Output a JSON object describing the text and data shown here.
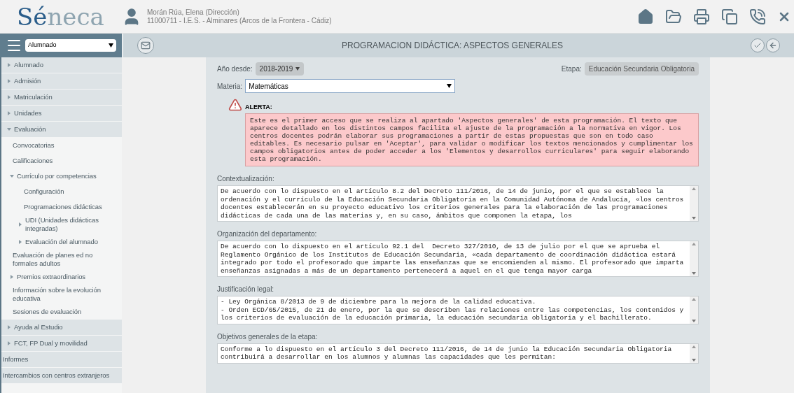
{
  "header": {
    "logo": "Séneca",
    "user_name": "Morán Rúa, Elena (Dirección)",
    "center": "11000711 - I.E.S. - Alminares (Arcos de la Frontera - Cádiz)"
  },
  "profile_select": {
    "value": "Alumnado"
  },
  "page_title": "PROGRAMACION DIDÁCTICA: ASPECTOS GENERALES",
  "sidebar": {
    "items": [
      {
        "label": "Alumnado",
        "expanded": false
      },
      {
        "label": "Admisión",
        "expanded": false
      },
      {
        "label": "Matriculación",
        "expanded": false
      },
      {
        "label": "Unidades",
        "expanded": false
      },
      {
        "label": "Evaluación",
        "expanded": true,
        "children": [
          {
            "label": "Convocatorias"
          },
          {
            "label": "Calificaciones"
          },
          {
            "label": "Currículo por competencias",
            "expanded": true,
            "children": [
              {
                "label": "Configuración"
              },
              {
                "label": "Programaciones didácticas"
              },
              {
                "label": "UDI (Unidades didácticas integradas)",
                "expanded": false
              },
              {
                "label": "Evaluación del alumnado",
                "expanded": false
              }
            ]
          },
          {
            "label": "Evaluación de planes ed no formales adultos"
          },
          {
            "label": "Premios extraordinarios",
            "expanded": false
          },
          {
            "label": "Información sobre la evolución educativa"
          },
          {
            "label": "Sesiones de evaluación"
          }
        ]
      },
      {
        "label": "Ayuda al Estudio",
        "expanded": false
      },
      {
        "label": "FCT, FP Dual y movilidad",
        "expanded": false
      },
      {
        "label": "Informes"
      },
      {
        "label": "Intercambios con centros extranjeros"
      }
    ]
  },
  "form": {
    "year": {
      "label": "Año desde:",
      "value": "2018-2019"
    },
    "stage": {
      "label": "Etapa:",
      "value": "Educación Secundaria Obligatoria"
    },
    "subject": {
      "label": "Materia:",
      "value": "Matemáticas"
    },
    "alert": {
      "title": "ALERTA:",
      "text": "Este es el primer acceso que se realiza al apartado 'Aspectos generales' de esta programación. El texto que aparece detallado en los distintos campos facilita el ajuste de la programación a la normativa en vigor. Los centros docentes podrán elaborar sus programaciones a partir de estas propuestas que son en todo caso editables. Es necesario pulsar en 'Aceptar', para validar o modificar los textos mencionados y cumplimentar los campos obligatorios antes de poder acceder a los 'Elementos y desarrollos curriculares' para seguir elaborando esta programación."
    },
    "sections": [
      {
        "label": "Contextualización:",
        "text": "De acuerdo con lo dispuesto en el artículo 8.2 del Decreto 111/2016, de 14 de junio, por el que se establece la ordenación y el currículo de la Educación Secundaria Obligatoria en la Comunidad Autónoma de Andalucía, «los centros docentes establecerán en su proyecto educativo los criterios generales para la elaboración de las programaciones didácticas de cada una de las materias y, en su caso, ámbitos que componen la etapa, los"
      },
      {
        "label": "Organización del departamento:",
        "text": "De acuerdo con lo dispuesto en el artículo 92.1 del  Decreto 327/2010, de 13 de julio por el que se aprueba el Reglamento Orgánico de los Institutos de Educación Secundaria, «cada departamento de coordinación didáctica estará integrado por todo el profesorado que imparte las enseñanzas que se encomienden al mismo. El profesorado que imparta enseñanzas asignadas a más de un departamento pertenecerá a aquel en el que tenga mayor carga"
      },
      {
        "label": "Justificación legal:",
        "text": "- Ley Orgánica 8/2013 de 9 de diciembre para la mejora de la calidad educativa.\n- Orden ECD/65/2015, de 21 de enero, por la que se describen las relaciones entre las competencias, los contenidos y los criterios de evaluación de la educación primaria, la educación secundaria obligatoria y el bachillerato."
      },
      {
        "label": "Objetivos generales de la etapa:",
        "text": "Conforme a lo dispuesto en el artículo 3 del Decreto 111/2016, de 14 de junio la Educación Secundaria Obligatoria contribuirá a desarrollar en los alumnos y alumnas las capacidades que les permitan:"
      }
    ]
  }
}
